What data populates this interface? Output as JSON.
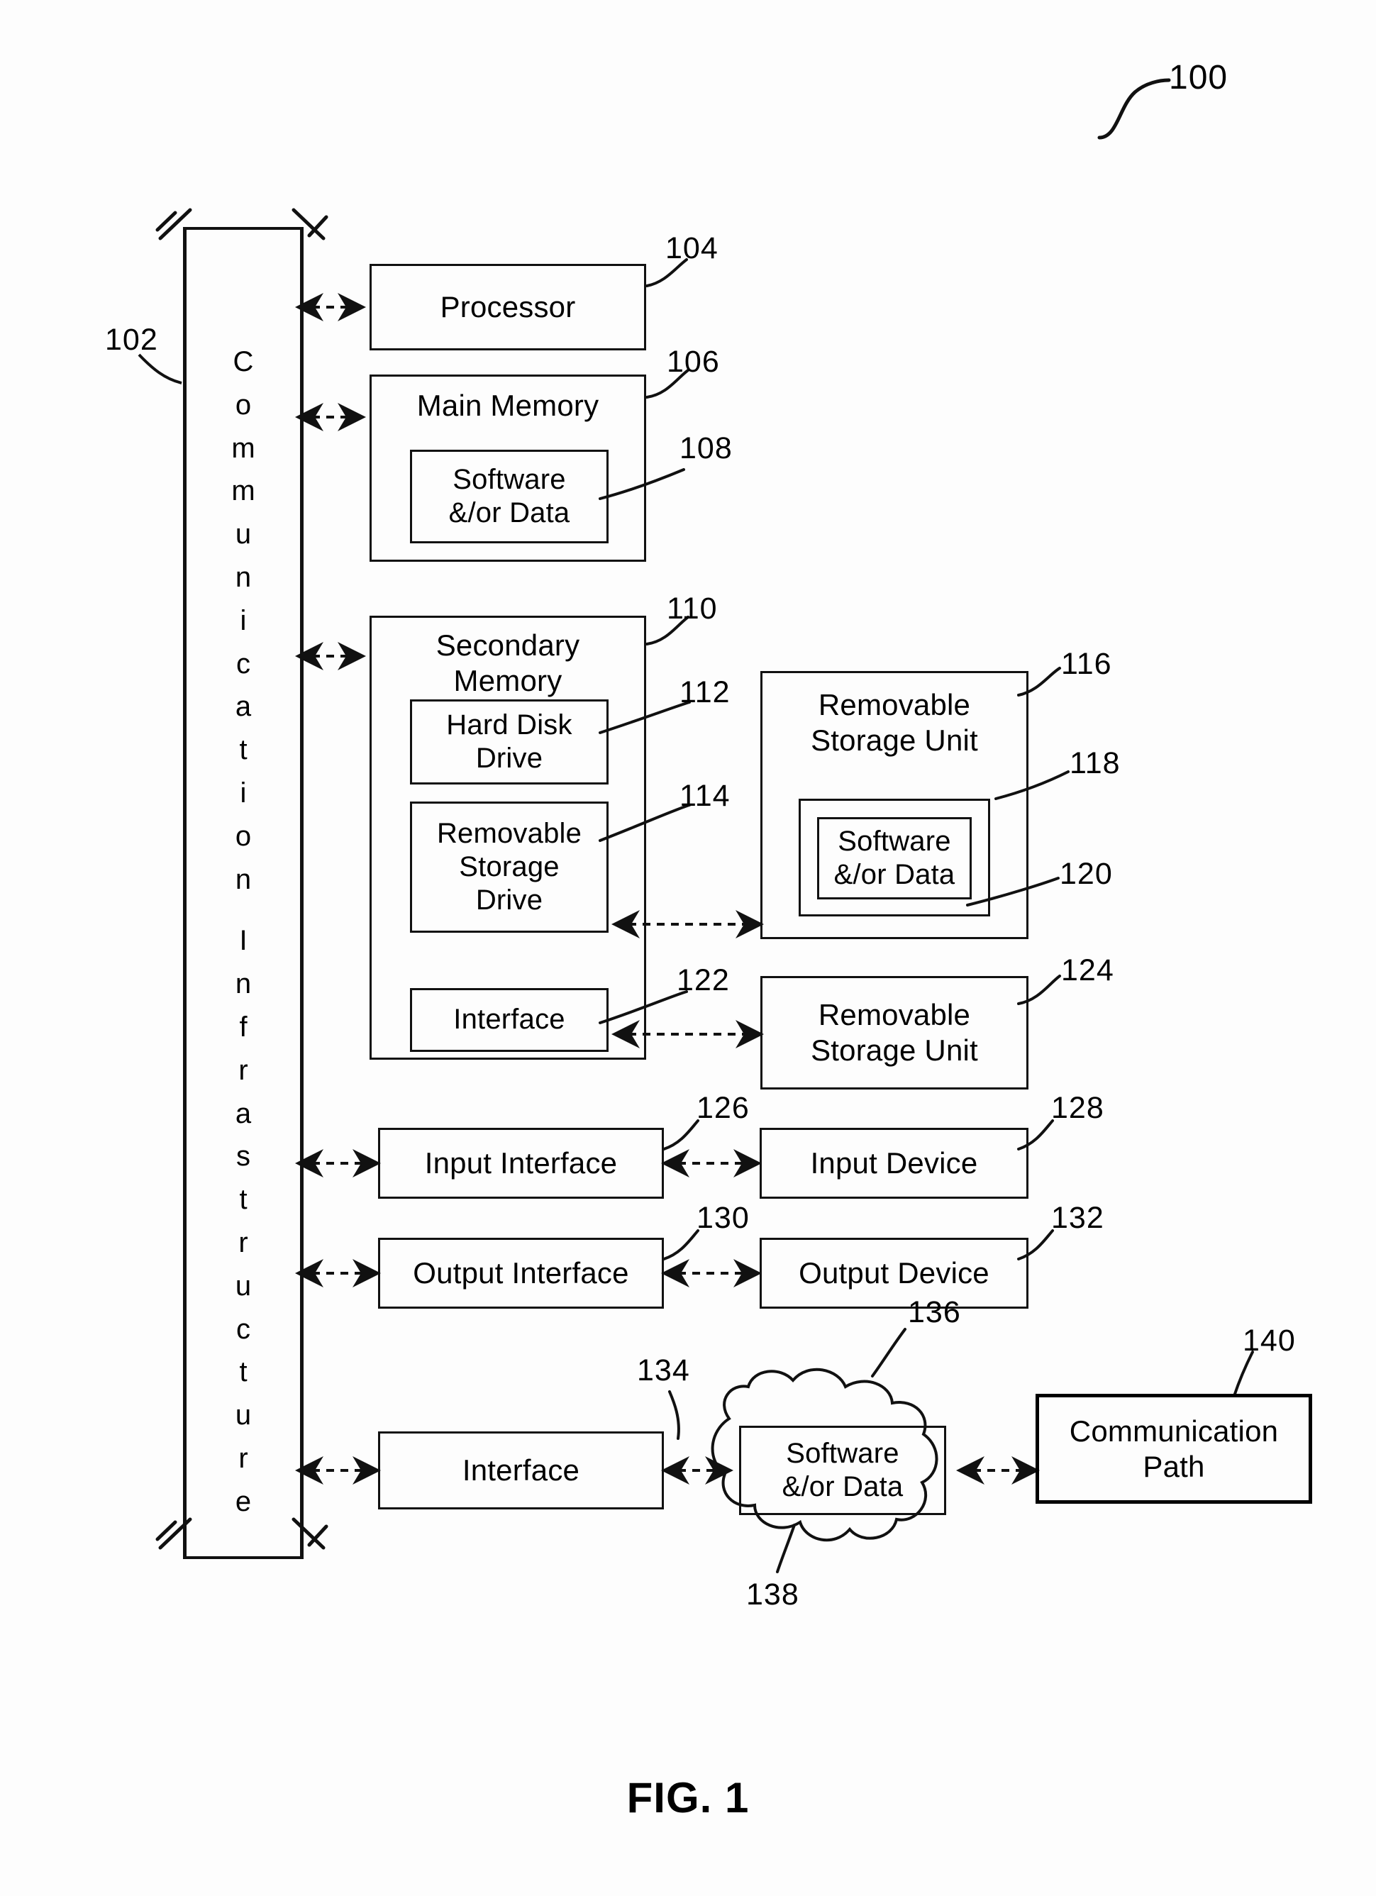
{
  "figure": {
    "caption": "FIG. 1",
    "system_ref": "100"
  },
  "bus": {
    "label": "Communication Infrastructure",
    "ref": "102",
    "letters": [
      "C",
      "o",
      "m",
      "m",
      "u",
      "n",
      "i",
      "c",
      "a",
      "t",
      "i",
      "o",
      "n",
      "",
      "I",
      "n",
      "f",
      "r",
      "a",
      "s",
      "t",
      "r",
      "u",
      "c",
      "t",
      "u",
      "r",
      "e"
    ]
  },
  "blocks": {
    "processor": {
      "label": "Processor",
      "ref": "104"
    },
    "main_memory": {
      "label": "Main Memory",
      "ref": "106"
    },
    "main_memory_software": {
      "label": "Software\n&/or Data",
      "ref": "108"
    },
    "secondary_memory": {
      "label": "Secondary\nMemory",
      "ref": "110"
    },
    "hard_disk_drive": {
      "label": "Hard Disk\nDrive",
      "ref": "112"
    },
    "removable_storage_drive": {
      "label": "Removable\nStorage\nDrive",
      "ref": "114"
    },
    "removable_storage_unit_1": {
      "label": "Removable\nStorage Unit",
      "ref": "116"
    },
    "removable_storage_unit_1_inner": {
      "label": "",
      "ref": "118"
    },
    "removable_storage_unit_1_software": {
      "label": "Software\n&/or Data",
      "ref": "120"
    },
    "interface_secondary": {
      "label": "Interface",
      "ref": "122"
    },
    "removable_storage_unit_2": {
      "label": "Removable\nStorage Unit",
      "ref": "124"
    },
    "input_interface": {
      "label": "Input Interface",
      "ref": "126"
    },
    "input_device": {
      "label": "Input Device",
      "ref": "128"
    },
    "output_interface": {
      "label": "Output Interface",
      "ref": "130"
    },
    "output_device": {
      "label": "Output Device",
      "ref": "132"
    },
    "interface_comm": {
      "label": "Interface",
      "ref": "134"
    },
    "signal_cloud": {
      "ref": "136"
    },
    "signal_software": {
      "label": "Software\n&/or Data",
      "ref": "138"
    },
    "communication_path": {
      "label": "Communication\nPath",
      "ref": "140"
    }
  },
  "refs": {
    "r100": "100",
    "r102": "102",
    "r104": "104",
    "r106": "106",
    "r108": "108",
    "r110": "110",
    "r112": "112",
    "r114": "114",
    "r116": "116",
    "r118": "118",
    "r120": "120",
    "r122": "122",
    "r124": "124",
    "r126": "126",
    "r128": "128",
    "r130": "130",
    "r132": "132",
    "r134": "134",
    "r136": "136",
    "r138": "138",
    "r140": "140"
  },
  "colors": {
    "ink": "#111111",
    "background": "#fdfdfd"
  }
}
